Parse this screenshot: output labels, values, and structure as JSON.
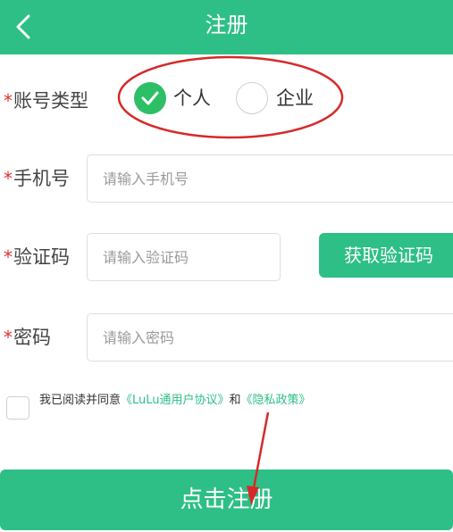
{
  "header": {
    "title": "注册"
  },
  "form": {
    "account_type": {
      "required_mark": "*",
      "label": "账号类型",
      "options": [
        {
          "label": "个人",
          "selected": true
        },
        {
          "label": "企业",
          "selected": false
        }
      ]
    },
    "phone": {
      "required_mark": "*",
      "label": "手机号",
      "placeholder": "请输入手机号",
      "value": ""
    },
    "code": {
      "required_mark": "*",
      "label": "验证码",
      "placeholder": "请输入验证码",
      "value": "",
      "button_label": "获取验证码"
    },
    "password": {
      "required_mark": "*",
      "label": "密码",
      "placeholder": "请输入密码",
      "value": ""
    },
    "agreement": {
      "checked": false,
      "prefix": "我已阅读并同意",
      "link1": "《LuLu通用户协议》",
      "middle": "和",
      "link2": "《隐私政策》"
    },
    "submit_label": "点击注册"
  },
  "colors": {
    "brand": "#2dbf86",
    "required": "#e0312f",
    "annotation": "#d62a2a"
  }
}
